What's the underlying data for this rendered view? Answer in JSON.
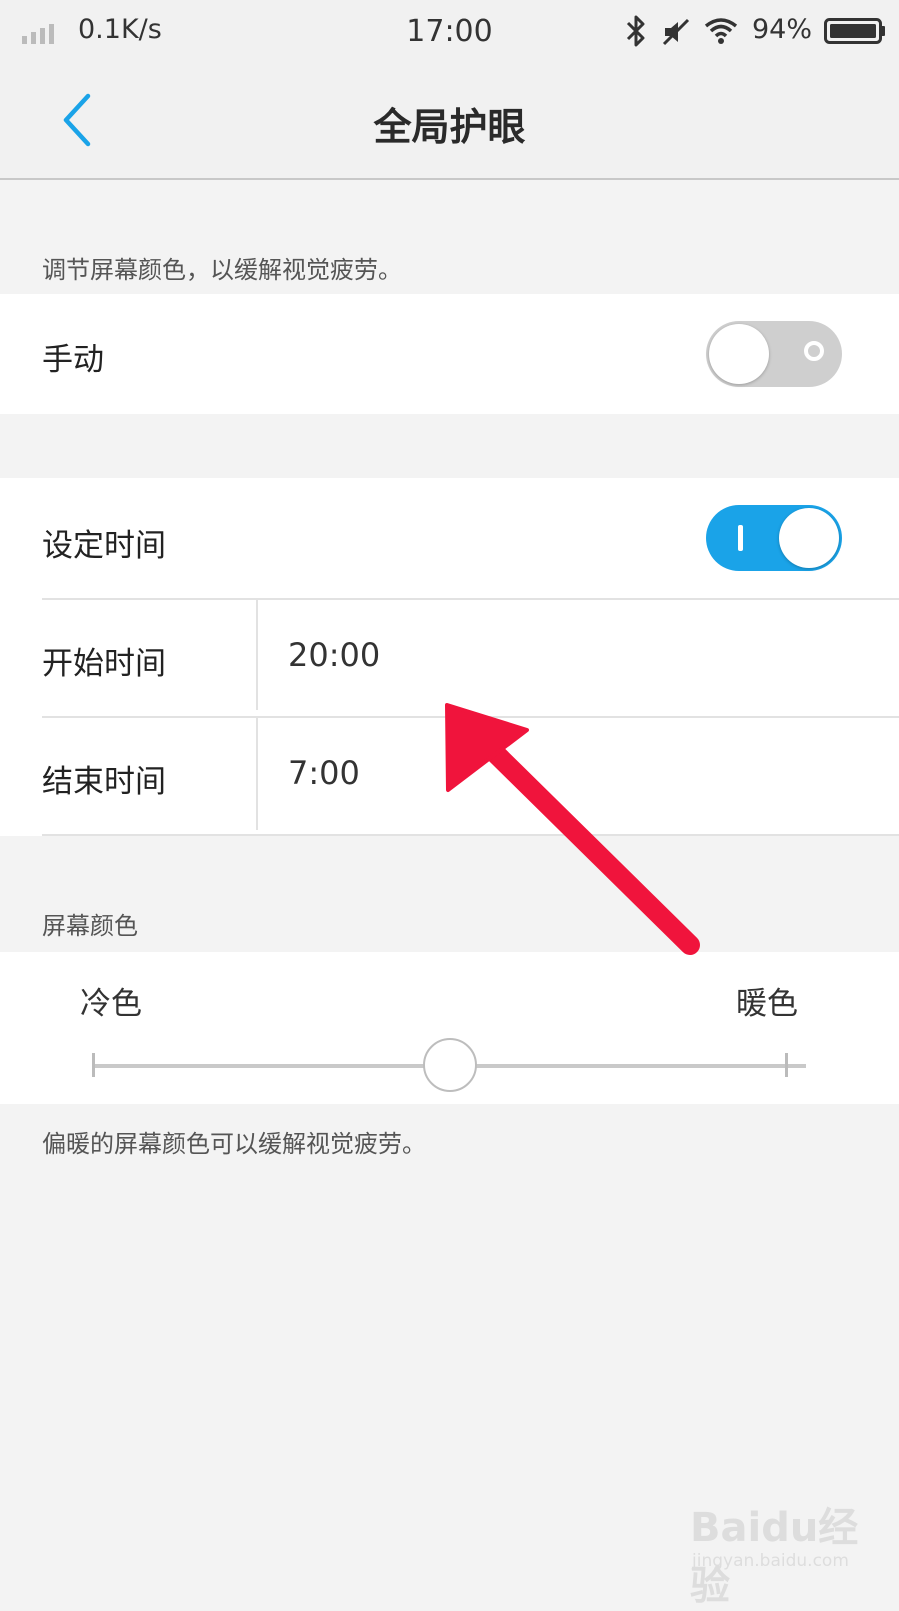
{
  "status_bar": {
    "net_speed": "0.1K/s",
    "time": "17:00",
    "battery_percent": "94%",
    "icons": [
      "signal-icon",
      "bluetooth-icon",
      "mute-icon",
      "wifi-icon",
      "battery-icon"
    ]
  },
  "nav": {
    "title": "全局护眼",
    "back_icon": "chevron-left-icon"
  },
  "intro_hint": "调节屏幕颜色，以缓解视觉疲劳。",
  "manual": {
    "label": "手动",
    "enabled": false
  },
  "schedule": {
    "label": "设定时间",
    "enabled": true,
    "start_label": "开始时间",
    "start_value": "20:00",
    "end_label": "结束时间",
    "end_value": "7:00"
  },
  "screen_color": {
    "section_title": "屏幕颜色",
    "cool_label": "冷色",
    "warm_label": "暖色",
    "level": 0.5,
    "footer_hint": "偏暖的屏幕颜色可以缓解视觉疲劳。"
  },
  "colors": {
    "accent": "#1aa3e8",
    "annotation_arrow": "#f0143c"
  },
  "watermark": {
    "logo_text": "Baidu经验",
    "url": "jingyan.baidu.com"
  }
}
